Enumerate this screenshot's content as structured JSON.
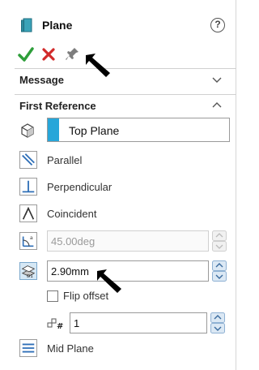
{
  "header": {
    "title": "Plane",
    "help_glyph": "?"
  },
  "actions": {
    "ok_icon": "checkmark-icon",
    "cancel_icon": "x-icon",
    "pin_icon": "pushpin-icon"
  },
  "sections": {
    "message": "Message",
    "first_reference": "First Reference"
  },
  "first_reference": {
    "selection": "Top Plane",
    "swatch_color": "#27a6d9",
    "options": {
      "parallel": "Parallel",
      "perpendicular": "Perpendicular",
      "coincident": "Coincident"
    },
    "angle": {
      "value": "45.00deg",
      "enabled": false
    },
    "offset": {
      "value": "2.90mm",
      "selected": true
    },
    "flip_offset": {
      "label": "Flip offset",
      "checked": false
    },
    "instances": {
      "value": "1"
    },
    "mid_plane": "Mid Plane"
  },
  "colors": {
    "accept": "#2e9e3a",
    "cancel": "#d22a2a",
    "accent": "#27a6d9",
    "icon_blue": "#2f6fb7"
  }
}
